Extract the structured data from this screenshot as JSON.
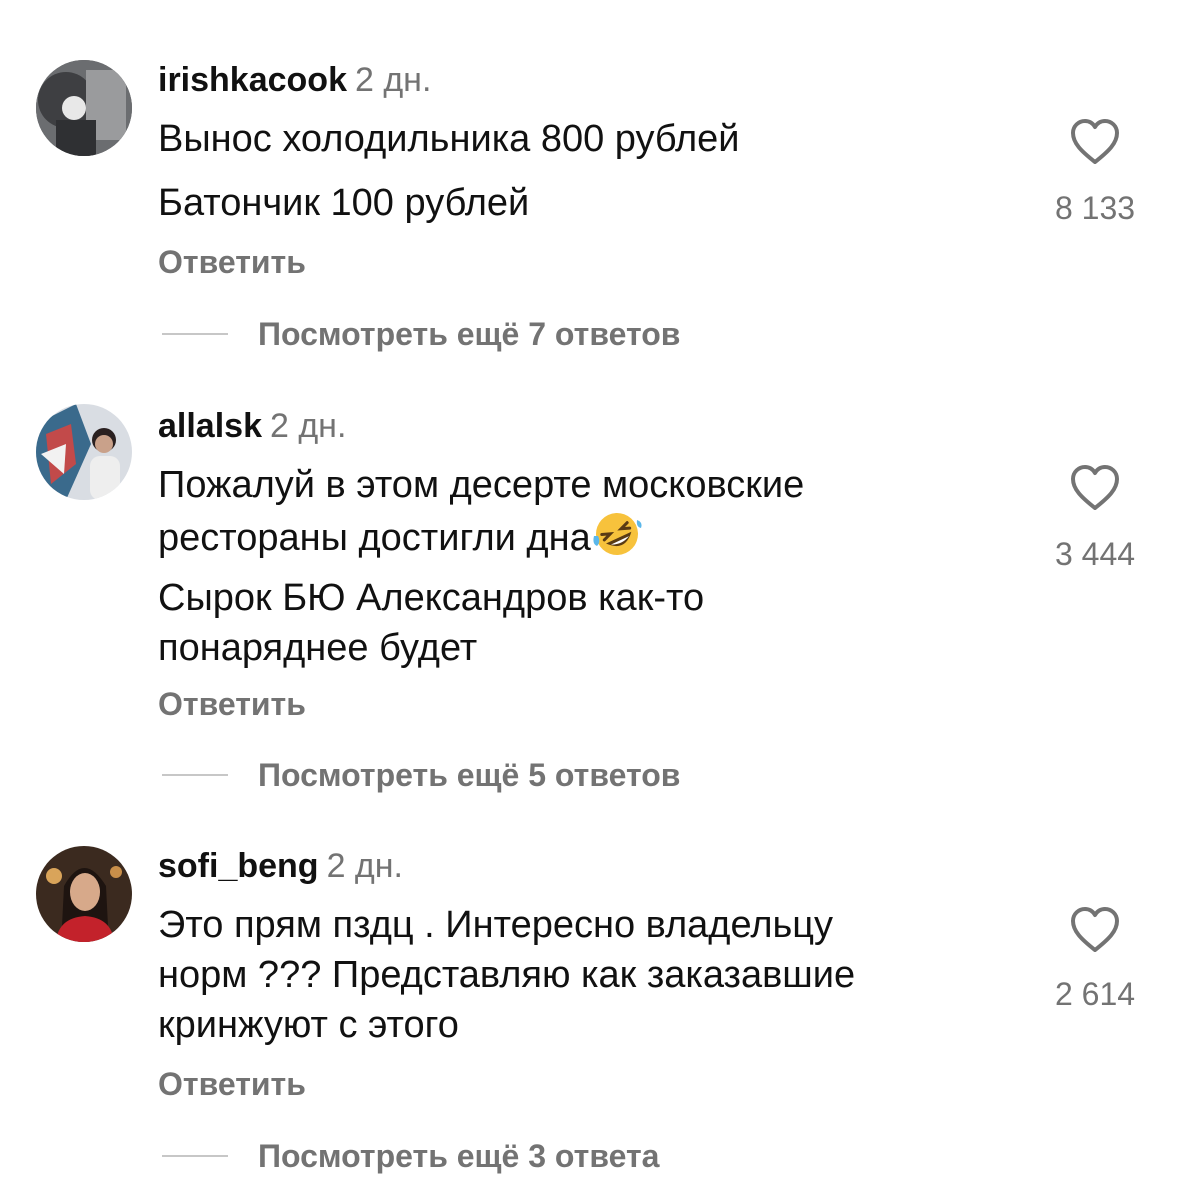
{
  "comments": [
    {
      "username": "irishkacook",
      "time": "2 дн.",
      "lines": [
        "Вынос холодильника 800 рублей",
        "Батончик 100 рублей"
      ],
      "reply_label": "Ответить",
      "like_count": "8 133",
      "more_replies": "Посмотреть ещё 7 ответов",
      "avatar_icon": "avatar-photo"
    },
    {
      "username": "allalsk",
      "time": "2 дн.",
      "lines": [
        "Пожалуй в этом десерте московские",
        "рестораны достигли дна",
        "Сырок БЮ Александров как-то",
        "понаряднее будет"
      ],
      "emoji": "rolling-on-floor-laughing-emoji",
      "reply_label": "Ответить",
      "like_count": "3 444",
      "more_replies": "Посмотреть ещё 5 ответов",
      "avatar_icon": "avatar-photo"
    },
    {
      "username": "sofi_beng",
      "time": "2 дн.",
      "lines": [
        "Это прям пздц . Интересно владельцу",
        "норм ??? Представляю как заказавшие",
        "кринжуют  с этого"
      ],
      "reply_label": "Ответить",
      "like_count": "2 614",
      "more_replies": "Посмотреть ещё 3 ответа",
      "avatar_icon": "avatar-photo"
    }
  ],
  "colors": {
    "text": "#111111",
    "secondary": "#737373",
    "divider": "#c7c7c7"
  },
  "icons": {
    "like": "heart-outline-icon"
  }
}
